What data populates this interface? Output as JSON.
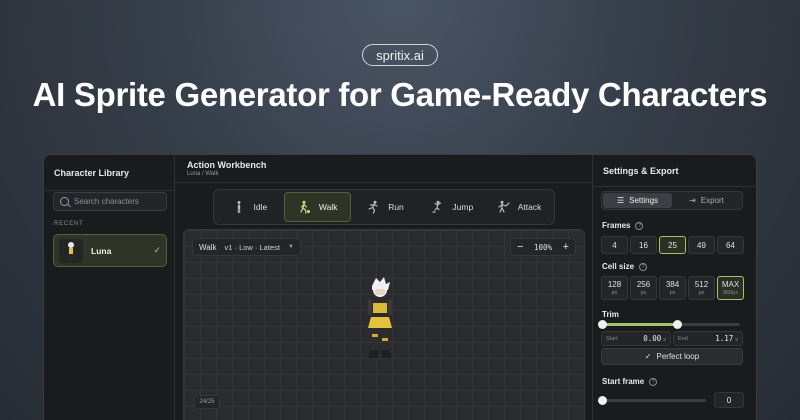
{
  "hero": {
    "brand": "spritix.ai",
    "title": "AI Sprite Generator for Game-Ready Characters"
  },
  "library": {
    "title": "Character Library",
    "search_placeholder": "Search characters",
    "section": "RECENT",
    "items": [
      {
        "name": "Luna",
        "selected": true
      }
    ]
  },
  "workbench": {
    "title": "Action Workbench",
    "breadcrumb": "Luna / Walk",
    "actions": [
      {
        "label": "Idle",
        "icon": "idle-icon"
      },
      {
        "label": "Walk",
        "icon": "walk-icon",
        "active": true
      },
      {
        "label": "Run",
        "icon": "run-icon"
      },
      {
        "label": "Jump",
        "icon": "jump-icon"
      },
      {
        "label": "Attack",
        "icon": "attack-icon"
      }
    ],
    "clip_name": "Walk",
    "clip_version": "v1 · Low · Latest",
    "zoom_minus": "−",
    "zoom": "100%",
    "zoom_plus": "+",
    "frame_counter": "24/25"
  },
  "settings": {
    "title": "Settings & Export",
    "tabs": {
      "settings": "Settings",
      "export": "Export"
    },
    "frames": {
      "label": "Frames",
      "help": "?",
      "options": [
        "4",
        "16",
        "25",
        "49",
        "64"
      ],
      "selected": "25"
    },
    "cell_size": {
      "label": "Cell size",
      "help": "?",
      "options": [
        {
          "value": "128",
          "sub": "px"
        },
        {
          "value": "256",
          "sub": "px"
        },
        {
          "value": "384",
          "sub": "px"
        },
        {
          "value": "512",
          "sub": "px"
        },
        {
          "value": "MAX",
          "sub": "960px"
        }
      ],
      "selected": "MAX"
    },
    "trim": {
      "label": "Trim",
      "start_label": "Start",
      "start_value": "0.00",
      "end_label": "End",
      "end_value": "1.17",
      "unit": "s",
      "range": [
        0,
        0.54
      ]
    },
    "perfect_loop": "Perfect loop",
    "start_frame": {
      "label": "Start frame",
      "help": "?",
      "value": "0",
      "level": 0
    }
  },
  "colors": {
    "accent": "#a3c36a",
    "panel": "#1a1b1d"
  }
}
